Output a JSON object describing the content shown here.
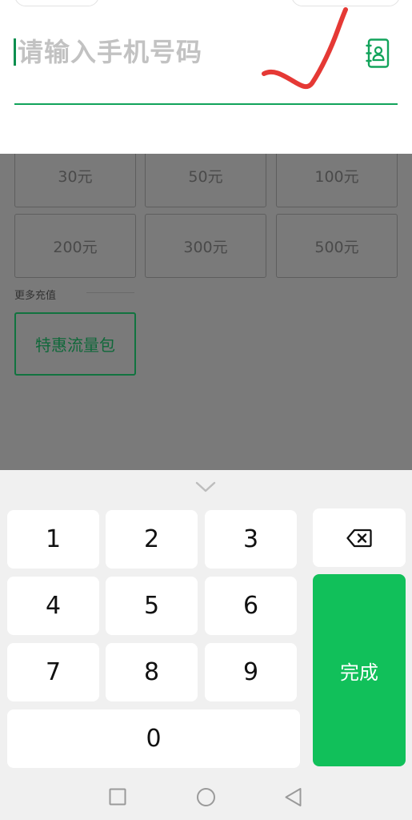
{
  "phone_input": {
    "placeholder": "请输入手机号码",
    "contacts_icon": "contacts-book-icon"
  },
  "annotation": {
    "mark_icon": "red-check-mark",
    "color": "#e53935"
  },
  "amounts": [
    "30元",
    "50元",
    "100元",
    "200元",
    "300元",
    "500元"
  ],
  "more_recharge": {
    "label": "更多充值",
    "items": [
      "特惠流量包"
    ]
  },
  "keyboard": {
    "collapse_icon": "chevron-down-icon",
    "keys": [
      "1",
      "2",
      "3",
      "4",
      "5",
      "6",
      "7",
      "8",
      "9",
      "0"
    ],
    "backspace_icon": "backspace-icon",
    "done_label": "完成",
    "done_color": "#11c05a"
  },
  "nav_bar": {
    "icons": [
      "recent-apps-icon",
      "home-icon",
      "back-icon"
    ]
  }
}
